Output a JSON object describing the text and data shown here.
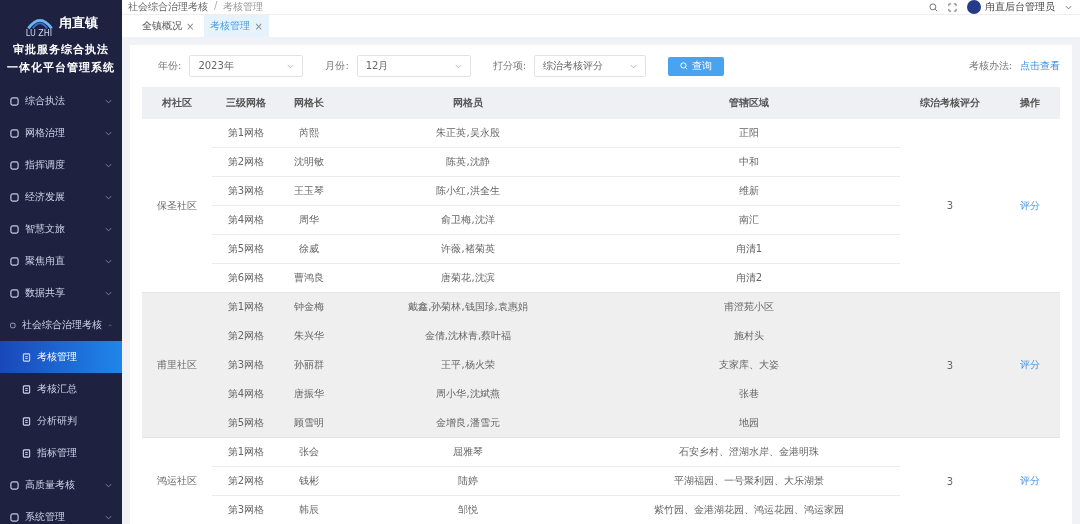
{
  "sidebar": {
    "logo_caption": "LU ZHI",
    "logo_name": "甪直镇",
    "title_lines": [
      "审批服务综合执法",
      "一体化平台管理系统"
    ],
    "items": [
      {
        "label": "综合执法",
        "kind": "group",
        "expanded": false
      },
      {
        "label": "网格治理",
        "kind": "group",
        "expanded": false
      },
      {
        "label": "指挥调度",
        "kind": "group",
        "expanded": false
      },
      {
        "label": "经济发展",
        "kind": "group",
        "expanded": false
      },
      {
        "label": "智慧文旅",
        "kind": "group",
        "expanded": false
      },
      {
        "label": "聚焦甪直",
        "kind": "group",
        "expanded": false
      },
      {
        "label": "数据共享",
        "kind": "group",
        "expanded": false
      },
      {
        "label": "社会综合治理考核",
        "kind": "group",
        "expanded": true,
        "children": [
          {
            "label": "考核管理",
            "selected": true
          },
          {
            "label": "考核汇总",
            "selected": false
          },
          {
            "label": "分析研判",
            "selected": false
          },
          {
            "label": "指标管理",
            "selected": false
          }
        ]
      },
      {
        "label": "高质量考核",
        "kind": "group",
        "expanded": false
      },
      {
        "label": "系统管理",
        "kind": "group",
        "expanded": false
      }
    ]
  },
  "breadcrumb": [
    "社会综合治理考核",
    "考核管理"
  ],
  "breadcrumb_separator": "/",
  "user": {
    "name": "甪直后台管理员"
  },
  "tabs": [
    {
      "label": "全镇概况",
      "selected": false,
      "close": "×"
    },
    {
      "label": "考核管理",
      "selected": true,
      "close": "×"
    }
  ],
  "filters": [
    {
      "label": "年份:",
      "value": "2023年"
    },
    {
      "label": "月份:",
      "value": "12月"
    },
    {
      "label": "打分项:",
      "value": "综治考核评分"
    }
  ],
  "search_button": "查询",
  "method": {
    "label": "考核办法:",
    "link": "点击查看"
  },
  "table": {
    "columns": [
      "村社区",
      "三级网格",
      "网格长",
      "网格员",
      "管辖区域",
      "综治考核评分",
      "操作"
    ],
    "groups": [
      {
        "community": "保圣社区",
        "highlighted": false,
        "score": "3",
        "action": "评分",
        "rows": [
          [
            "第1网格",
            "芮熙",
            "朱正英,吴永殷",
            "正阳"
          ],
          [
            "第2网格",
            "沈明敏",
            "陈英,沈静",
            "中和"
          ],
          [
            "第3网格",
            "王玉琴",
            "陈小红,洪全生",
            "维新"
          ],
          [
            "第4网格",
            "周华",
            "俞卫梅,沈洋",
            "南汇"
          ],
          [
            "第5网格",
            "徐威",
            "许薇,褚菊英",
            "甪清1"
          ],
          [
            "第6网格",
            "曹鸿良",
            "唐菊花,沈滨",
            "甪清2"
          ]
        ]
      },
      {
        "community": "甫里社区",
        "highlighted": true,
        "score": "3",
        "action": "评分",
        "rows": [
          [
            "第1网格",
            "钟金梅",
            "戴鑫,孙菊林,钱国珍,袁惠娟",
            "甫澄苑小区"
          ],
          [
            "第2网格",
            "朱兴华",
            "金倩,沈林青,蔡叶福",
            "施村头"
          ],
          [
            "第3网格",
            "孙丽群",
            "王平,杨火荣",
            "支家库、大姿"
          ],
          [
            "第4网格",
            "唐振华",
            "周小华,沈斌燕",
            "张巷"
          ],
          [
            "第5网格",
            "顾雪明",
            "金增良,潘雪元",
            "地园"
          ]
        ]
      },
      {
        "community": "鸿运社区",
        "highlighted": false,
        "score": "3",
        "action": "评分",
        "rows": [
          [
            "第1网格",
            "张会",
            "屈雅琴",
            "石安乡村、澄湖水岸、金港明珠"
          ],
          [
            "第2网格",
            "钱彬",
            "陆婷",
            "平湖福园、一号聚利园、大乐湖景"
          ],
          [
            "第3网格",
            "韩辰",
            "邹悦",
            "紫竹园、金港湖花园、鸿运花园、鸿运家园"
          ]
        ]
      }
    ]
  }
}
